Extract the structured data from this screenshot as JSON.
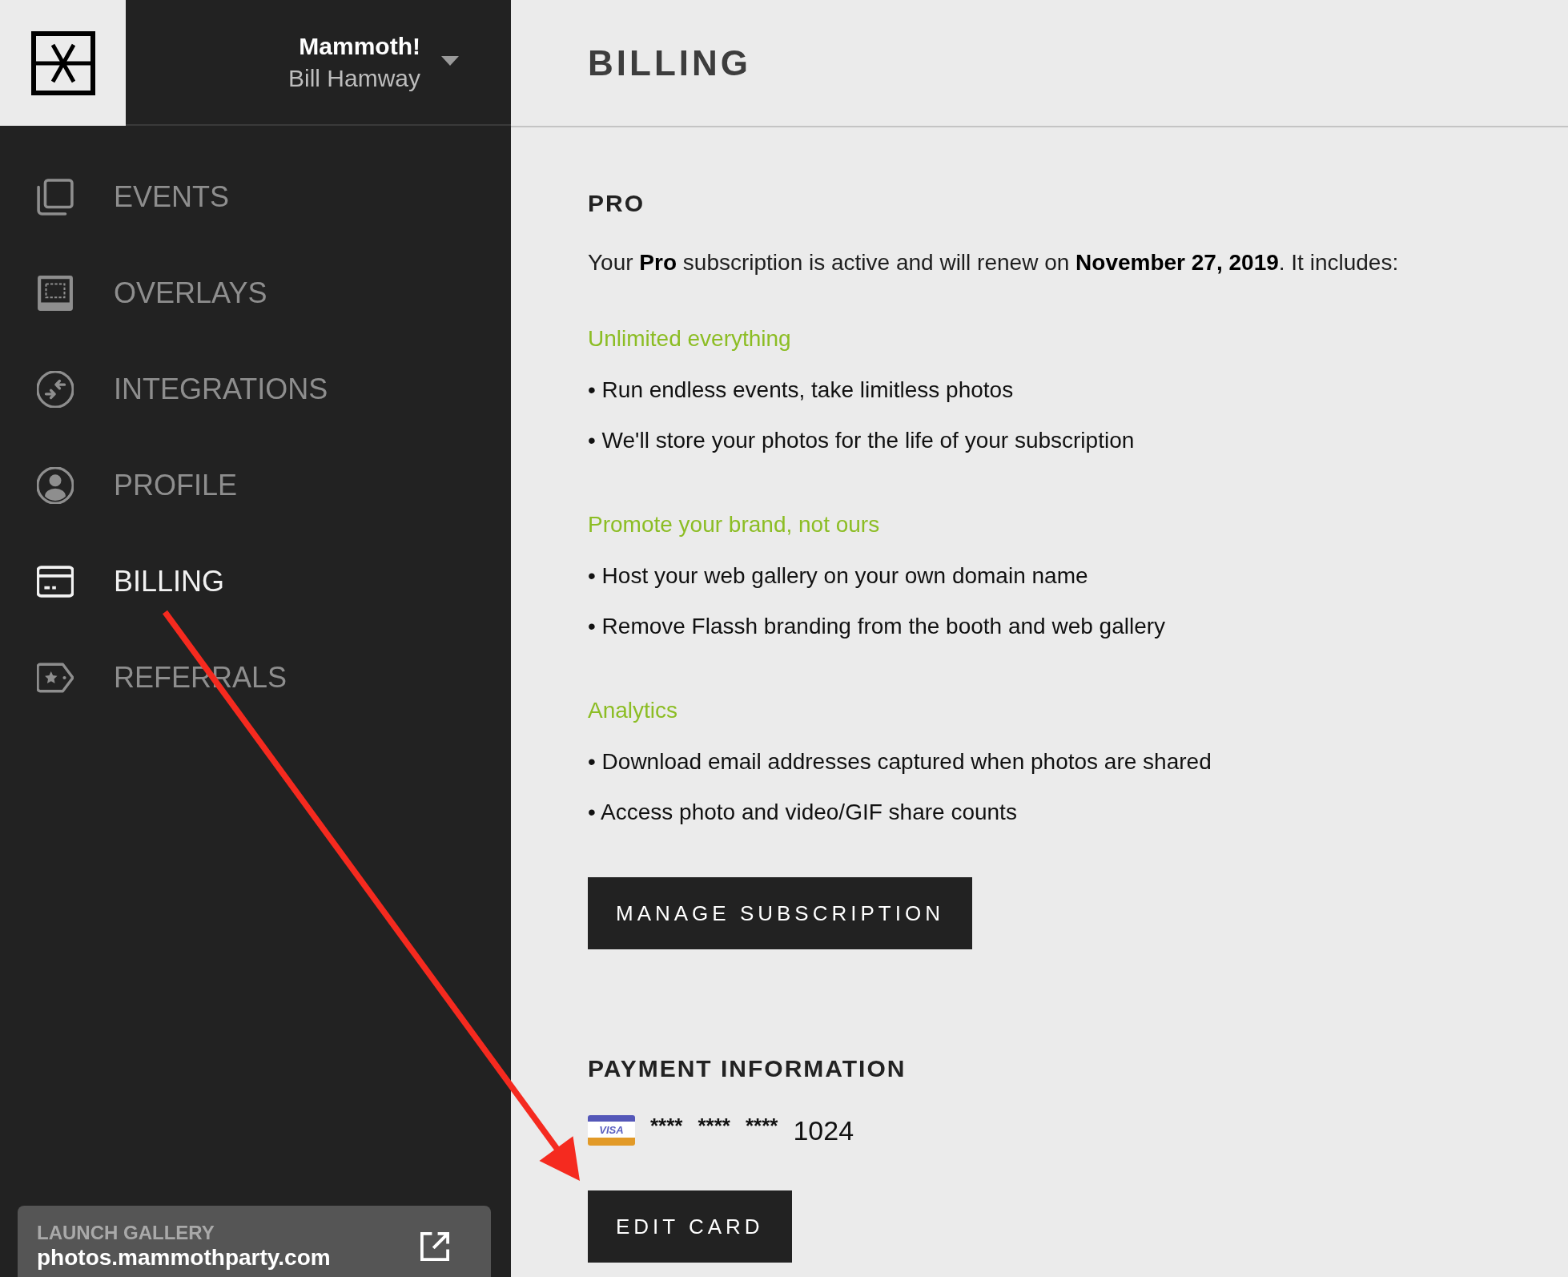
{
  "sidebar": {
    "account": {
      "team": "Mammoth!",
      "user": "Bill Hamway"
    },
    "nav": [
      {
        "label": "EVENTS",
        "selected": false
      },
      {
        "label": "OVERLAYS",
        "selected": false
      },
      {
        "label": "INTEGRATIONS",
        "selected": false
      },
      {
        "label": "PROFILE",
        "selected": false
      },
      {
        "label": "BILLING",
        "selected": true
      },
      {
        "label": "REFERRALS",
        "selected": false
      }
    ],
    "launch_gallery": {
      "label": "LAUNCH GALLERY",
      "url": "photos.mammothparty.com"
    }
  },
  "page": {
    "title": "BILLING"
  },
  "plan": {
    "heading": "PRO",
    "summary": "Your **Pro** subscription is active and will renew on **November 27, 2019**. It includes:",
    "features": [
      {
        "title": "Unlimited everything",
        "items": [
          "• Run endless events, take limitless photos",
          "• We'll store your photos for the life of your subscription"
        ]
      },
      {
        "title": "Promote your brand, not ours",
        "items": [
          "• Host your web gallery on your own domain name",
          "• Remove Flassh branding from the booth and web gallery"
        ]
      },
      {
        "title": "Analytics",
        "items": [
          "• Download email addresses captured when photos are shared",
          "• Access photo and video/GIF share counts"
        ]
      }
    ],
    "button": "MANAGE SUBSCRIPTION"
  },
  "payment": {
    "heading": "PAYMENT INFORMATION",
    "card": {
      "logo_text": "VISA",
      "masked_groups": [
        "****",
        "****",
        "****"
      ],
      "last4": "1024"
    },
    "button": "EDIT CARD"
  }
}
